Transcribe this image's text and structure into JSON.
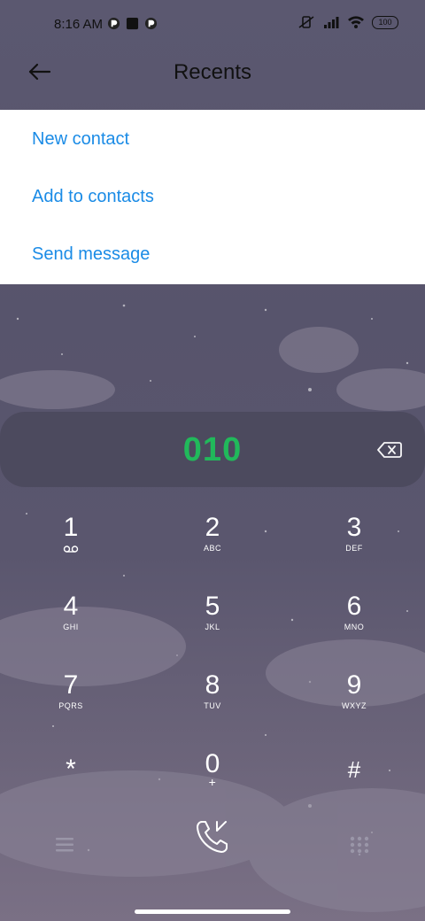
{
  "status_bar": {
    "time": "8:16 AM",
    "battery": "100"
  },
  "header": {
    "title": "Recents"
  },
  "menu": {
    "items": [
      "New contact",
      "Add to contacts",
      "Send message"
    ]
  },
  "dialer": {
    "number": "010"
  },
  "keypad": {
    "keys": [
      {
        "digit": "1",
        "sub": ""
      },
      {
        "digit": "2",
        "sub": "ABC"
      },
      {
        "digit": "3",
        "sub": "DEF"
      },
      {
        "digit": "4",
        "sub": "GHI"
      },
      {
        "digit": "5",
        "sub": "JKL"
      },
      {
        "digit": "6",
        "sub": "MNO"
      },
      {
        "digit": "7",
        "sub": "PQRS"
      },
      {
        "digit": "8",
        "sub": "TUV"
      },
      {
        "digit": "9",
        "sub": "WXYZ"
      },
      {
        "digit": "*",
        "sub": ""
      },
      {
        "digit": "0",
        "sub": "+"
      },
      {
        "digit": "#",
        "sub": ""
      }
    ]
  },
  "icons": {
    "back": "back-arrow-icon",
    "backspace": "backspace-icon",
    "call": "call-icon",
    "menu": "menu-lines-icon",
    "dialpad": "dialpad-icon",
    "voicemail": "voicemail-icon"
  },
  "colors": {
    "accent_blue": "#1a8be6",
    "number_green": "#1fbf5b"
  }
}
